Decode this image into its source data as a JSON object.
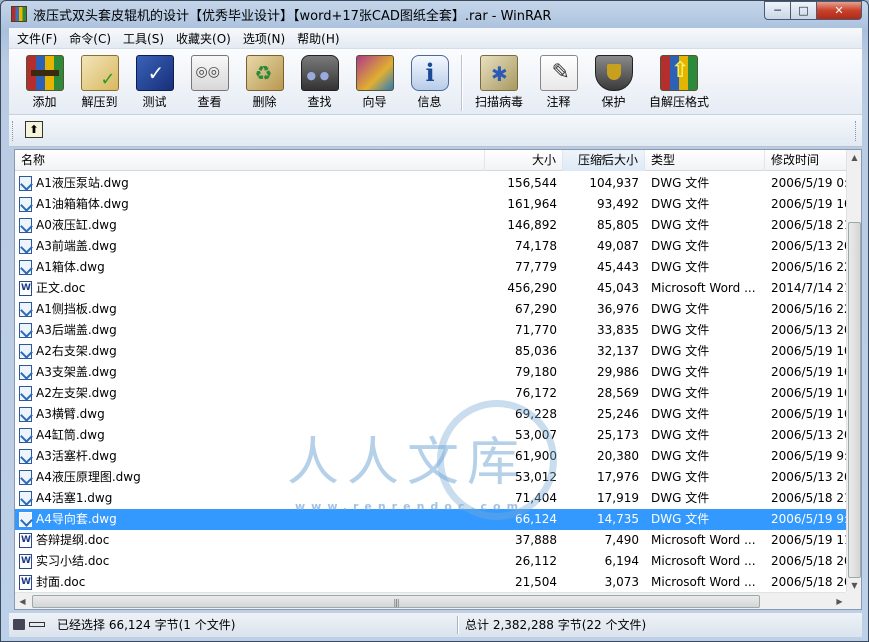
{
  "window": {
    "title": "液压式双头套皮辊机的设计【优秀毕业设计】【word+17张CAD图纸全套】.rar - WinRAR",
    "controls": {
      "minimize": "─",
      "maximize": "□",
      "close": "✕"
    }
  },
  "menu": [
    "文件(F)",
    "命令(C)",
    "工具(S)",
    "收藏夹(O)",
    "选项(N)",
    "帮助(H)"
  ],
  "toolbar": {
    "group1": [
      {
        "label": "添加",
        "icon": "add-archive-icon"
      },
      {
        "label": "解压到",
        "icon": "extract-to-icon"
      },
      {
        "label": "测试",
        "icon": "test-icon"
      },
      {
        "label": "查看",
        "icon": "view-icon"
      },
      {
        "label": "删除",
        "icon": "delete-icon"
      },
      {
        "label": "查找",
        "icon": "find-icon"
      },
      {
        "label": "向导",
        "icon": "wizard-icon"
      },
      {
        "label": "信息",
        "icon": "info-icon"
      }
    ],
    "group2": [
      {
        "label": "扫描病毒",
        "icon": "virus-scan-icon"
      },
      {
        "label": "注释",
        "icon": "comment-icon"
      },
      {
        "label": "保护",
        "icon": "protect-icon"
      },
      {
        "label": "自解压格式",
        "icon": "sfx-icon"
      }
    ]
  },
  "list": {
    "headers": {
      "name": "名称",
      "size": "大小",
      "packed": "压缩后大小",
      "type": "类型",
      "modified": "修改时间"
    },
    "sort_column": "packed",
    "rows": [
      {
        "name": "A1液压泵站.dwg",
        "size": "156,544",
        "packed": "104,937",
        "type": "DWG 文件",
        "modified": "2006/5/19 0:",
        "kind": "dwg"
      },
      {
        "name": "A1油箱箱体.dwg",
        "size": "161,964",
        "packed": "93,492",
        "type": "DWG 文件",
        "modified": "2006/5/19 10",
        "kind": "dwg"
      },
      {
        "name": "A0液压缸.dwg",
        "size": "146,892",
        "packed": "85,805",
        "type": "DWG 文件",
        "modified": "2006/5/18 21",
        "kind": "dwg"
      },
      {
        "name": "A3前端盖.dwg",
        "size": "74,178",
        "packed": "49,087",
        "type": "DWG 文件",
        "modified": "2006/5/13 20",
        "kind": "dwg"
      },
      {
        "name": "A1箱体.dwg",
        "size": "77,779",
        "packed": "45,443",
        "type": "DWG 文件",
        "modified": "2006/5/16 22",
        "kind": "dwg"
      },
      {
        "name": "正文.doc",
        "size": "456,290",
        "packed": "45,043",
        "type": "Microsoft Word ...",
        "modified": "2014/7/14 21",
        "kind": "doc"
      },
      {
        "name": "A1侧挡板.dwg",
        "size": "67,290",
        "packed": "36,976",
        "type": "DWG 文件",
        "modified": "2006/5/16 22",
        "kind": "dwg"
      },
      {
        "name": "A3后端盖.dwg",
        "size": "71,770",
        "packed": "33,835",
        "type": "DWG 文件",
        "modified": "2006/5/13 20",
        "kind": "dwg"
      },
      {
        "name": "A2右支架.dwg",
        "size": "85,036",
        "packed": "32,137",
        "type": "DWG 文件",
        "modified": "2006/5/19 10",
        "kind": "dwg"
      },
      {
        "name": "A3支架盖.dwg",
        "size": "79,180",
        "packed": "29,986",
        "type": "DWG 文件",
        "modified": "2006/5/19 10",
        "kind": "dwg"
      },
      {
        "name": "A2左支架.dwg",
        "size": "76,172",
        "packed": "28,569",
        "type": "DWG 文件",
        "modified": "2006/5/19 10",
        "kind": "dwg"
      },
      {
        "name": "A3横臂.dwg",
        "size": "69,228",
        "packed": "25,246",
        "type": "DWG 文件",
        "modified": "2006/5/19 10",
        "kind": "dwg"
      },
      {
        "name": "A4缸筒.dwg",
        "size": "53,007",
        "packed": "25,173",
        "type": "DWG 文件",
        "modified": "2006/5/13 20",
        "kind": "dwg"
      },
      {
        "name": "A3活塞杆.dwg",
        "size": "61,900",
        "packed": "20,380",
        "type": "DWG 文件",
        "modified": "2006/5/19 9:",
        "kind": "dwg"
      },
      {
        "name": "A4液压原理图.dwg",
        "size": "53,012",
        "packed": "17,976",
        "type": "DWG 文件",
        "modified": "2006/5/13 20",
        "kind": "dwg"
      },
      {
        "name": "A4活塞1.dwg",
        "size": "71,404",
        "packed": "17,919",
        "type": "DWG 文件",
        "modified": "2006/5/18 21",
        "kind": "dwg"
      },
      {
        "name": "A4导向套.dwg",
        "size": "66,124",
        "packed": "14,735",
        "type": "DWG 文件",
        "modified": "2006/5/19 9:",
        "kind": "dwg",
        "selected": true
      },
      {
        "name": "答辩提纲.doc",
        "size": "37,888",
        "packed": "7,490",
        "type": "Microsoft Word ...",
        "modified": "2006/5/19 11",
        "kind": "doc"
      },
      {
        "name": "实习小结.doc",
        "size": "26,112",
        "packed": "6,194",
        "type": "Microsoft Word ...",
        "modified": "2006/5/18 20",
        "kind": "doc"
      },
      {
        "name": "封面.doc",
        "size": "21,504",
        "packed": "3,073",
        "type": "Microsoft Word ...",
        "modified": "2006/5/18 20",
        "kind": "doc"
      }
    ]
  },
  "watermark": {
    "text": "人人文库",
    "url": "www.renrendoc.com"
  },
  "status": {
    "left": "已经选择 66,124 字节(1 个文件)",
    "right": "总计 2,382,288 字节(22 个文件)"
  },
  "colors": {
    "selection": "#3399ff"
  }
}
